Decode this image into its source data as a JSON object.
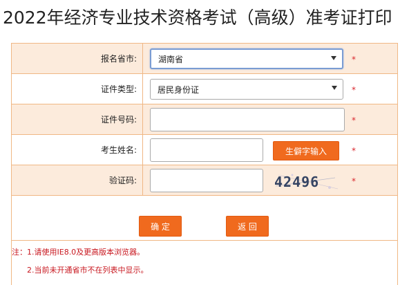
{
  "page": {
    "title": "2022年经济专业技术资格考试（高级）准考证打印"
  },
  "form": {
    "region": {
      "label": "报名省市:",
      "value": "湖南省",
      "required_mark": "*"
    },
    "id_type": {
      "label": "证件类型:",
      "value": "居民身份证",
      "required_mark": "*"
    },
    "id_number": {
      "label": "证件号码:",
      "value": "",
      "required_mark": "*"
    },
    "name": {
      "label": "考生姓名:",
      "value": "",
      "rare_char_button": "生僻字输入",
      "required_mark": "*"
    },
    "captcha": {
      "label": "验证码:",
      "value": "",
      "image_text": "42496",
      "required_mark": "*"
    },
    "actions": {
      "confirm": "确 定",
      "back": "返 回"
    }
  },
  "notes": {
    "line1": "注：1.请使用IE8.0及更高版本浏览器。",
    "line2": "2.当前未开通省市不在列表中显示。"
  },
  "colors": {
    "accent_button": "#f06a1e",
    "required_mark": "#d9272e",
    "row_shade": "#fcebdc",
    "border": "#f0b784"
  }
}
